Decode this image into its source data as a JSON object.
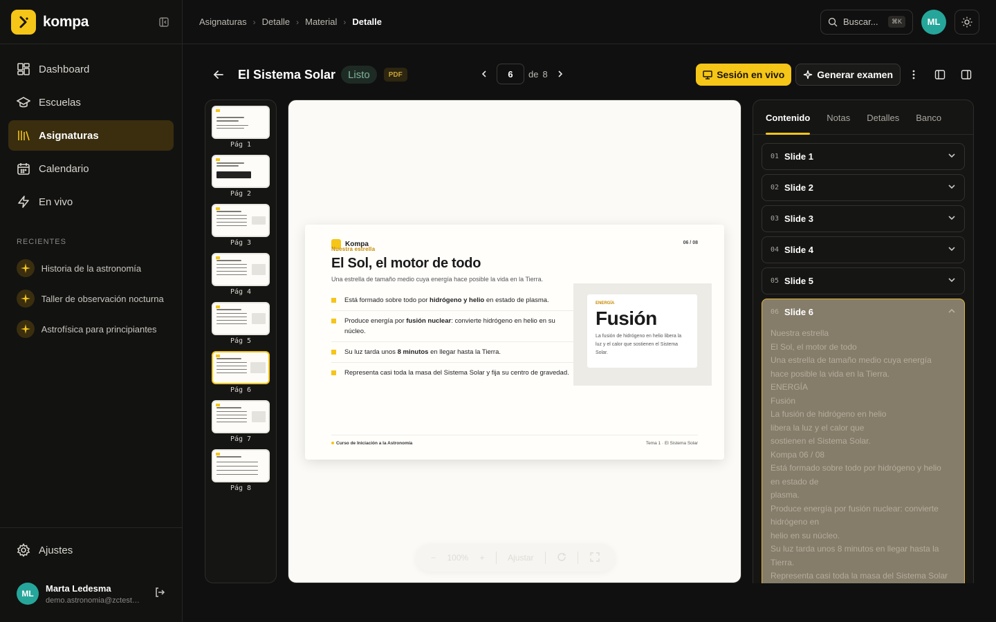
{
  "app": {
    "name": "kompa"
  },
  "sidebar": {
    "nav": [
      {
        "label": "Dashboard",
        "icon": "dashboard-icon"
      },
      {
        "label": "Escuelas",
        "icon": "school-icon"
      },
      {
        "label": "Asignaturas",
        "icon": "library-icon",
        "active": true
      },
      {
        "label": "Calendario",
        "icon": "calendar-icon"
      },
      {
        "label": "En vivo",
        "icon": "bolt-icon"
      }
    ],
    "recent_label": "RECIENTES",
    "recent": [
      {
        "label": "Historia de la astronomía"
      },
      {
        "label": "Taller de observación nocturna"
      },
      {
        "label": "Astrofísica para principiantes"
      }
    ],
    "settings_label": "Ajustes",
    "user": {
      "initials": "ML",
      "name": "Marta Ledesma",
      "email": "demo.astronomia@zctest.com"
    }
  },
  "topbar": {
    "breadcrumb": [
      "Asignaturas",
      "Detalle",
      "Material",
      "Detalle"
    ],
    "search_placeholder": "Buscar...",
    "search_shortcut": "⌘K",
    "avatar_initials": "ML"
  },
  "header": {
    "title": "El Sistema Solar",
    "status": "Listo",
    "file_type": "PDF",
    "page_current": "6",
    "page_of": "de",
    "page_total": "8",
    "live_button": "Sesión en vivo",
    "exam_button": "Generar examen"
  },
  "thumbnails": [
    {
      "label": "Pág 1"
    },
    {
      "label": "Pág 2"
    },
    {
      "label": "Pág 3"
    },
    {
      "label": "Pág 4"
    },
    {
      "label": "Pág 5"
    },
    {
      "label": "Pág 6",
      "active": true
    },
    {
      "label": "Pág 7"
    },
    {
      "label": "Pág 8"
    }
  ],
  "slide": {
    "brand": "Kompa",
    "eyebrow": "Nuestra estrella",
    "page": "06 / 08",
    "title": "El Sol, el motor de todo",
    "subtitle": "Una estrella de tamaño medio cuya energía hace posible la vida en la Tierra.",
    "bullets": [
      {
        "pre": "Está formado sobre todo por ",
        "bold": "hidrógeno y helio",
        "post": " en estado de plasma."
      },
      {
        "pre": "Produce energía por ",
        "bold": "fusión nuclear",
        "post": ": convierte hidrógeno en helio en su núcleo."
      },
      {
        "pre": "Su luz tarda unos ",
        "bold": "8 minutos",
        "post": " en llegar hasta la Tierra."
      },
      {
        "pre": "Representa casi toda la masa del Sistema Solar y fija su centro de gravedad.",
        "bold": "",
        "post": ""
      }
    ],
    "card_kicker": "ENERGÍA",
    "card_title": "Fusión",
    "card_text": "La fusión de hidrógeno en helio libera la luz y el calor que sostienen el Sistema Solar.",
    "footer_left": "Curso de Iniciación a la Astronomía",
    "footer_right": "Tema 1 · El Sistema Solar"
  },
  "zoom": {
    "minus": "−",
    "value": "100%",
    "plus": "+",
    "fit": "Ajustar"
  },
  "right_panel": {
    "tabs": [
      "Contenido",
      "Notas",
      "Detalles",
      "Banco"
    ],
    "slides": [
      {
        "no": "01",
        "label": "Slide 1"
      },
      {
        "no": "02",
        "label": "Slide 2"
      },
      {
        "no": "03",
        "label": "Slide 3"
      },
      {
        "no": "04",
        "label": "Slide 4"
      },
      {
        "no": "05",
        "label": "Slide 5"
      }
    ],
    "open_slide": {
      "no": "06",
      "label": "Slide 6",
      "lines": [
        "Nuestra estrella",
        "El Sol, el motor de todo",
        "Una estrella de tamaño medio cuya energía",
        "hace posible la vida en la Tierra.",
        "ENERGÍA",
        "Fusión",
        "La fusión de hidrógeno en helio",
        "libera la luz y el calor que",
        "sostienen el Sistema Solar.",
        "Kompa 06 / 08",
        "Está formado sobre todo por hidrógeno y helio",
        "en estado de",
        "plasma.",
        "Produce energía por fusión nuclear: convierte",
        "hidrógeno en",
        "helio en su núcleo.",
        "Su luz tarda unos 8 minutos en llegar hasta la",
        "Tierra.",
        "Representa casi toda la masa del Sistema Solar"
      ]
    }
  },
  "colors": {
    "accent": "#f5c518",
    "background": "#101010",
    "avatar": "#26a69a"
  }
}
